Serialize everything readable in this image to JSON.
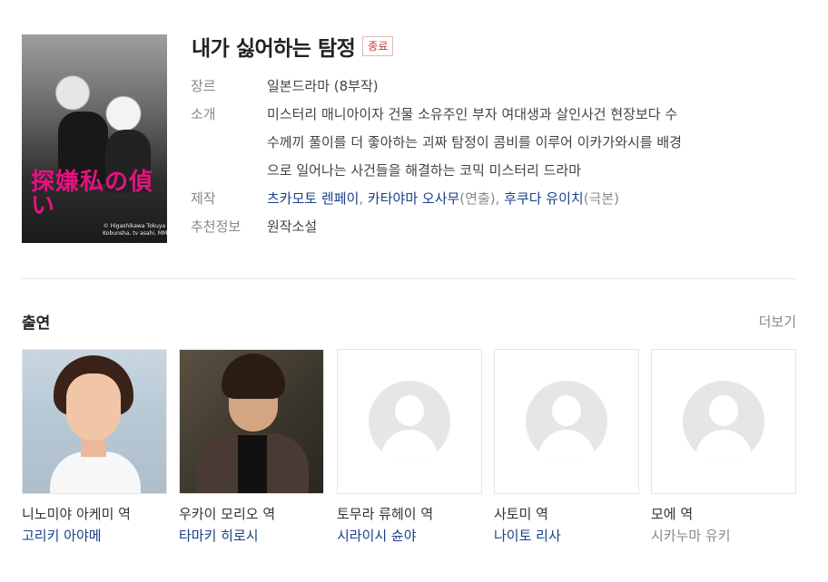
{
  "drama": {
    "title": "내가 싫어하는 탐정",
    "status_badge": "종료",
    "poster_title_line": "내가 싫어하는 탐정",
    "poster_kanji": "探嫌私の偵い",
    "poster_copyright": "© Higashikawa Tokuya / Kobunsha, tv asahi, MMJ",
    "genre_label": "장르",
    "genre_value": "일본드라마 (8부작)",
    "intro_label": "소개",
    "intro_lines": [
      "미스터리 매니아이자 건물 소유주인 부자 여대생과 살인사건 현장보다 수",
      "수께끼 풀이를 더 좋아하는 괴짜 탐정이 콤비를 이루어 이카가와시를 배경",
      "으로 일어나는 사건들을 해결하는 코믹 미스터리 드라마"
    ],
    "production_label": "제작",
    "production": {
      "director1": "츠카모토 렌페이",
      "sep1": ", ",
      "director2": "카타야마 오사무",
      "role1": "(연출), ",
      "writer": "후쿠다 유이치",
      "role2": "(극본)"
    },
    "recommend_label": "추천정보",
    "recommend_value": "원작소설"
  },
  "cast_section": {
    "title": "출연",
    "more": "더보기",
    "members": [
      {
        "role": "니노미야 아케미 역",
        "actor": "고리키 아야메",
        "linked": true
      },
      {
        "role": "우카이 모리오 역",
        "actor": "타마키 히로시",
        "linked": true
      },
      {
        "role": "토무라 류헤이 역",
        "actor": "시라이시 슌야",
        "linked": true
      },
      {
        "role": "사토미 역",
        "actor": "나이토 리사",
        "linked": true
      },
      {
        "role": "모에 역",
        "actor": "시카누마 유키",
        "linked": false
      }
    ]
  },
  "colors": {
    "link": "#1a3f8a",
    "badge": "#c24040",
    "poster_accent": "#e4127f"
  }
}
